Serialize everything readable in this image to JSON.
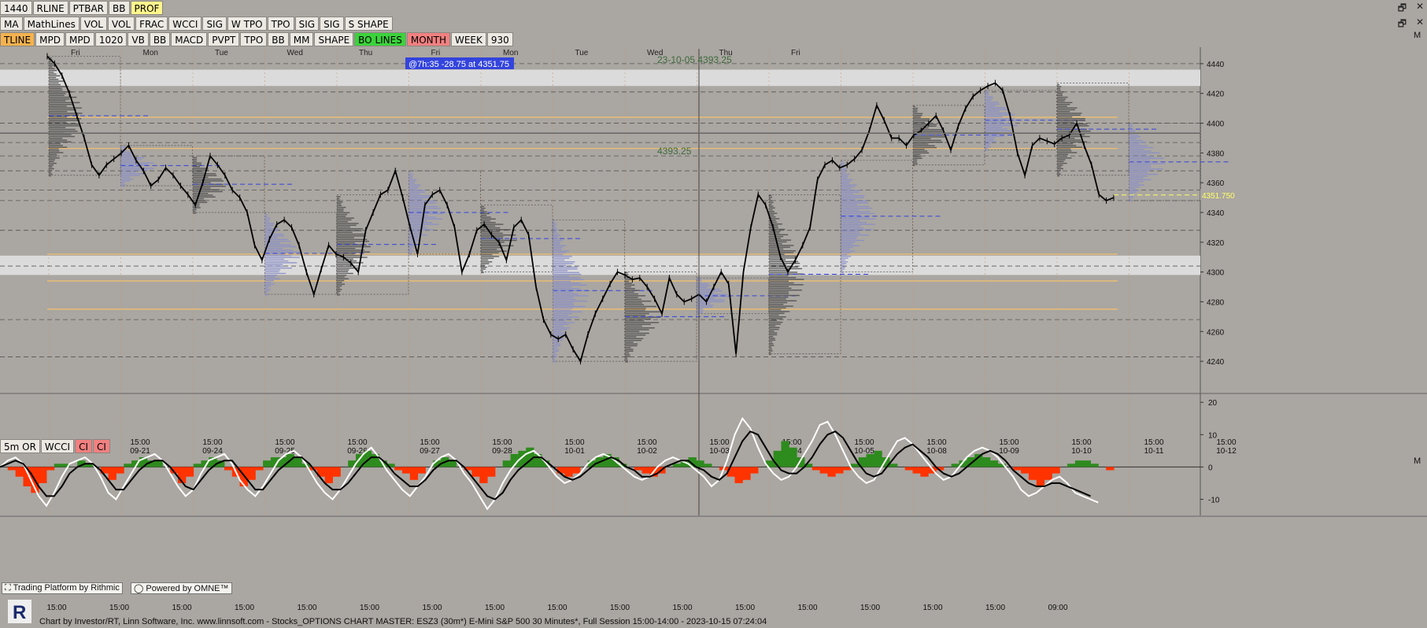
{
  "toolbar1": [
    "1440",
    "RLINE",
    "PTBAR",
    "BB",
    "PROF"
  ],
  "toolbar2": [
    "MA",
    "MathLines",
    "VOL",
    "VOL",
    "FRAC",
    "WCCI",
    "SIG",
    "W TPO",
    "TPO",
    "SIG",
    "SIG",
    "S SHAPE"
  ],
  "toolbar3": [
    "TLINE",
    "MPD",
    "MPD",
    "1020",
    "VB",
    "BB",
    "MACD",
    "PVPT",
    "TPO",
    "BB",
    "MM",
    "SHAPE",
    "BO LINES",
    "MONTH",
    "WEEK",
    "930"
  ],
  "indicator_toolbar": [
    "5m OR",
    "WCCI",
    "CI",
    "CI"
  ],
  "window_controls": {
    "restore": "🗗",
    "close": "✕",
    "m": "M"
  },
  "cursor_label": "@7h:35  -28.75 at 4351.75",
  "crosshair_labels": {
    "date_price": "23-10-05 4393.25",
    "price": "4393.25"
  },
  "last_price_tag": "4351.750",
  "footer": "Chart by Investor/RT, Linn Software, Inc. www.linnsoft.com - Stocks_OPTIONS CHART MASTER: ESZ3 (30m*) E-Mini S&P 500 30 Minutes*, Full Session 15:00-14:00 - 2023-10-15 07:24:04",
  "rithmic_label": "Trading Platform by Rithmic",
  "omne_label": "Powered by OMNE™",
  "colors": {
    "background": "#aaa6a1",
    "candles": "#000000",
    "profile": "#8a8fc8",
    "profile_dark": "#505050",
    "value_line": "#f5c26b",
    "poc_blue": "#3344dd",
    "band": "#dcdbdb",
    "osc_pos": "#2e8b1e",
    "osc_neg": "#ff3300"
  },
  "chart_data": [
    {
      "type": "line",
      "title": "",
      "ylabel": "",
      "ylim": [
        4230,
        4450
      ],
      "yticks": [
        4240,
        4260,
        4280,
        4300,
        4320,
        4340,
        4360,
        4380,
        4400,
        4420,
        4440
      ],
      "top_day_labels": [
        "Fri",
        "Mon",
        "Tue",
        "Wed",
        "Thu",
        "Fri",
        "Mon",
        "Tue",
        "Wed",
        "Thu",
        "Fri"
      ],
      "x_tick_time": "15:00",
      "x_tick_dates": [
        "09-21",
        "09-24",
        "09-25",
        "09-26",
        "09-27",
        "09-28",
        "10-01",
        "10-02",
        "10-03",
        "10-04",
        "10-05",
        "10-08",
        "10-09",
        "10-10",
        "10-11",
        "10-12"
      ],
      "bands": [
        [
          4425,
          4436
        ],
        [
          4298,
          4311
        ]
      ],
      "series": [
        {
          "values": [
            4445,
            4440,
            4432,
            4420,
            4405,
            4390,
            4372,
            4365,
            4372,
            4376,
            4380,
            4385,
            4375,
            4368,
            4358,
            4362,
            4370,
            4365,
            4358,
            4352,
            4345,
            4360,
            4378,
            4372,
            4365,
            4355,
            4350,
            4340,
            4318,
            4308,
            4322,
            4332,
            4335,
            4330,
            4318,
            4300,
            4285,
            4302,
            4318,
            4312,
            4310,
            4306,
            4300,
            4328,
            4340,
            4352,
            4355,
            4368,
            4350,
            4330,
            4312,
            4345,
            4352,
            4355,
            4345,
            4330,
            4300,
            4312,
            4328,
            4332,
            4325,
            4320,
            4308,
            4330,
            4335,
            4325,
            4290,
            4268,
            4258,
            4255,
            4258,
            4248,
            4240,
            4258,
            4272,
            4282,
            4292,
            4300,
            4298,
            4295,
            4296,
            4290,
            4282,
            4272,
            4296,
            4285,
            4280,
            4282,
            4285,
            4280,
            4290,
            4300,
            4292,
            4245,
            4300,
            4330,
            4352,
            4345,
            4330,
            4310,
            4300,
            4308,
            4318,
            4330,
            4362,
            4372,
            4375,
            4370,
            4372,
            4376,
            4382,
            4395,
            4412,
            4402,
            4390,
            4390,
            4385,
            4392,
            4395,
            4400,
            4405,
            4395,
            4382,
            4398,
            4410,
            4418,
            4422,
            4425,
            4427,
            4422,
            4405,
            4380,
            4365,
            4385,
            4390,
            4388,
            4386,
            4390,
            4392,
            4400,
            4385,
            4372,
            4352,
            4348,
            4350
          ]
        }
      ]
    },
    {
      "type": "area",
      "title": "",
      "ylim": [
        -15,
        22
      ],
      "yticks": [
        20,
        10,
        0,
        -10
      ],
      "x_tick_time": "15:00",
      "x_tick_last": "09:00",
      "series": [
        {
          "values": [
            0,
            -1,
            -3,
            -6,
            -8,
            -5,
            -1,
            1,
            1,
            0,
            2,
            1,
            0,
            -2,
            -4,
            -2,
            1,
            2,
            3,
            2,
            2,
            0,
            -2,
            -5,
            -3,
            1,
            2,
            3,
            2,
            -1,
            -3,
            -6,
            -4,
            -1,
            2,
            3,
            3,
            4,
            3,
            1,
            -1,
            -3,
            -5,
            -3,
            0,
            2,
            4,
            5,
            4,
            2,
            1,
            -1,
            -2,
            -4,
            -2,
            0,
            2,
            3,
            2,
            0,
            -1,
            -3,
            -5,
            -3,
            0,
            2,
            4,
            5,
            6,
            4,
            2,
            0,
            -2,
            -3,
            -2,
            0,
            2,
            3,
            4,
            3,
            1,
            0,
            -1,
            -2,
            -3,
            -2,
            0,
            1,
            2,
            3,
            2,
            1,
            0,
            -1,
            -3,
            -5,
            -4,
            -2,
            0,
            2,
            5,
            8,
            6,
            3,
            1,
            -1,
            -2,
            -3,
            -2,
            -1,
            1,
            3,
            4,
            5,
            3,
            1,
            0,
            -1,
            -2,
            -3,
            -2,
            -1,
            0,
            1,
            2,
            3,
            4,
            3,
            2,
            1,
            0,
            -1,
            -2,
            -4,
            -6,
            -4,
            -2,
            0,
            1,
            2,
            2,
            1,
            0,
            -1,
            -2
          ]
        },
        {
          "values": [
            0,
            2,
            3,
            1,
            -4,
            -9,
            -12,
            -8,
            -3,
            1,
            2,
            3,
            1,
            -3,
            -8,
            -10,
            -6,
            -2,
            2,
            3,
            4,
            2,
            -2,
            -6,
            -9,
            -7,
            -2,
            2,
            3,
            4,
            1,
            -4,
            -7,
            -9,
            -6,
            -2,
            2,
            4,
            5,
            3,
            -1,
            -5,
            -8,
            -10,
            -7,
            -3,
            1,
            4,
            6,
            3,
            -1,
            -4,
            -7,
            -9,
            -6,
            -3,
            1,
            3,
            4,
            2,
            -2,
            -5,
            -9,
            -13,
            -10,
            -5,
            -1,
            2,
            4,
            5,
            3,
            0,
            -3,
            -5,
            -4,
            -2,
            1,
            3,
            4,
            3,
            1,
            -1,
            -3,
            -4,
            -3,
            0,
            2,
            3,
            2,
            1,
            -1,
            -3,
            -6,
            -4,
            2,
            10,
            15,
            12,
            6,
            1,
            -2,
            -4,
            -3,
            0,
            4,
            8,
            13,
            14,
            10,
            5,
            0,
            -3,
            -5,
            -4,
            0,
            4,
            8,
            9,
            7,
            4,
            1,
            -2,
            -4,
            -3,
            0,
            3,
            5,
            6,
            5,
            3,
            0,
            -3,
            -7,
            -9,
            -8,
            -6,
            -4,
            -3,
            -5,
            -8,
            -9,
            -10,
            -11
          ]
        },
        {
          "values": [
            0,
            1,
            2,
            1,
            -2,
            -6,
            -9,
            -9,
            -6,
            -2,
            0,
            1,
            1,
            -1,
            -4,
            -7,
            -7,
            -4,
            -1,
            1,
            2,
            2,
            0,
            -3,
            -6,
            -7,
            -4,
            -1,
            1,
            2,
            2,
            -1,
            -4,
            -7,
            -7,
            -4,
            -1,
            1,
            3,
            3,
            1,
            -2,
            -5,
            -7,
            -7,
            -5,
            -2,
            1,
            3,
            3,
            1,
            -2,
            -4,
            -6,
            -6,
            -4,
            -1,
            1,
            2,
            2,
            0,
            -3,
            -6,
            -9,
            -10,
            -8,
            -4,
            -1,
            1,
            3,
            3,
            1,
            -1,
            -3,
            -4,
            -3,
            -1,
            1,
            2,
            3,
            2,
            0,
            -1,
            -3,
            -3,
            -2,
            0,
            1,
            2,
            2,
            0,
            -1,
            -3,
            -4,
            -2,
            3,
            8,
            11,
            10,
            6,
            2,
            -1,
            -2,
            -2,
            0,
            3,
            7,
            10,
            11,
            9,
            5,
            1,
            -2,
            -3,
            -2,
            1,
            4,
            6,
            7,
            5,
            3,
            0,
            -2,
            -3,
            -2,
            0,
            2,
            4,
            5,
            4,
            2,
            -1,
            -3,
            -5,
            -6,
            -6,
            -5,
            -5,
            -6,
            -7,
            -8,
            -9
          ]
        }
      ]
    }
  ]
}
